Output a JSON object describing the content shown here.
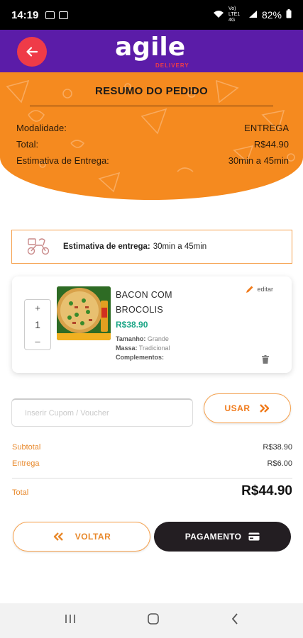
{
  "status_bar": {
    "time": "14:19",
    "network": "Vo) LTE1 4G",
    "battery": "82%"
  },
  "app": {
    "logo_text": "agile",
    "logo_subtext": "DELIVERY",
    "brand_color": "#5b1ca8",
    "accent_color": "#f58a1f"
  },
  "summary": {
    "title": "RESUMO DO PEDIDO",
    "rows": [
      {
        "label": "Modalidade:",
        "value": "ENTREGA"
      },
      {
        "label": "Total:",
        "value": "R$44.90"
      },
      {
        "label": "Estimativa de Entrega:",
        "value": "30min a 45min"
      }
    ]
  },
  "estimate": {
    "label": "Estimativa de entrega:",
    "value": "30min a 45min"
  },
  "item": {
    "name": "BACON COM BROCOLIS",
    "price": "R$38.90",
    "quantity": "1",
    "plus": "+",
    "minus": "–",
    "edit_label": "editar",
    "details": [
      {
        "label": "Tamanho:",
        "value": "Grande"
      },
      {
        "label": "Massa:",
        "value": "Tradicional"
      },
      {
        "label": "Complementos:",
        "value": ""
      }
    ]
  },
  "coupon": {
    "placeholder": "Inserir Cupom / Voucher",
    "button_label": "USAR"
  },
  "totals": {
    "subtotal_label": "Subtotal",
    "subtotal_value": "R$38.90",
    "delivery_label": "Entrega",
    "delivery_value": "R$6.00",
    "total_label": "Total",
    "total_value": "R$44.90"
  },
  "actions": {
    "back_label": "VOLTAR",
    "pay_label": "PAGAMENTO"
  }
}
